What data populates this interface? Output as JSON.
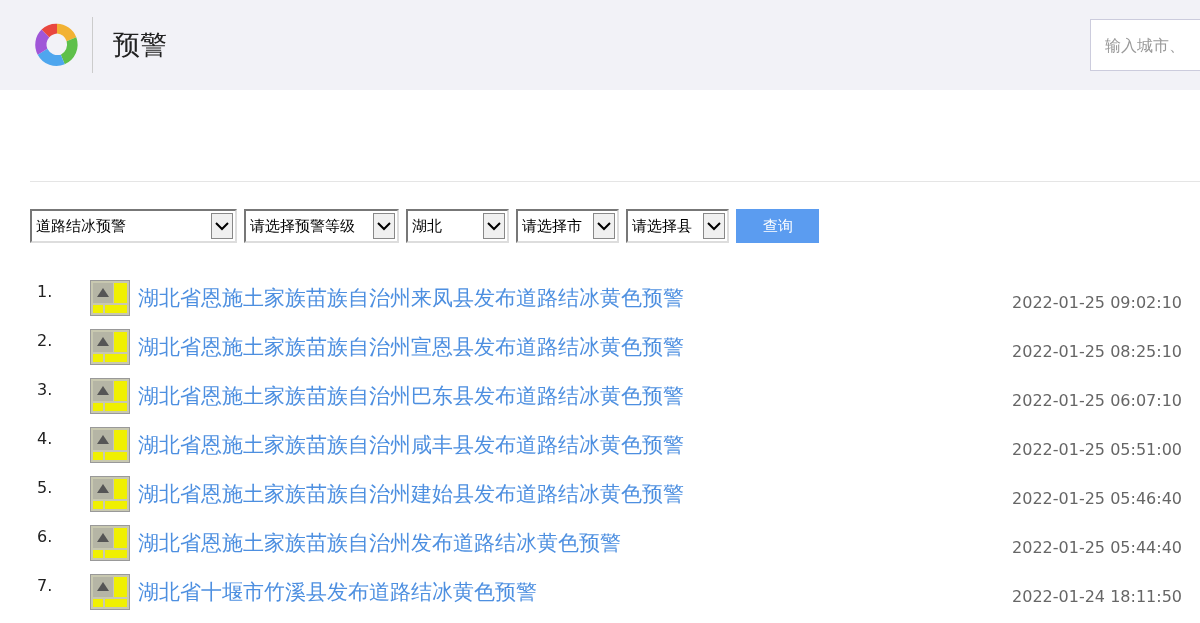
{
  "header": {
    "title": "预警",
    "search": {
      "placeholder": "输入城市、"
    }
  },
  "filters": [
    {
      "value": "道路结冰预警",
      "kind": "wide"
    },
    {
      "value": "请选择预警等级",
      "kind": "mid"
    },
    {
      "value": "湖北",
      "kind": "narrow"
    },
    {
      "value": "请选择市",
      "kind": "narrow"
    },
    {
      "value": "请选择县",
      "kind": "narrow"
    }
  ],
  "query_button": "查询",
  "alerts": [
    {
      "index": "1.",
      "title": "湖北省恩施土家族苗族自治州来凤县发布道路结冰黄色预警",
      "time": "2022-01-25 09:02:10"
    },
    {
      "index": "2.",
      "title": "湖北省恩施土家族苗族自治州宣恩县发布道路结冰黄色预警",
      "time": "2022-01-25 08:25:10"
    },
    {
      "index": "3.",
      "title": "湖北省恩施土家族苗族自治州巴东县发布道路结冰黄色预警",
      "time": "2022-01-25 06:07:10"
    },
    {
      "index": "4.",
      "title": "湖北省恩施土家族苗族自治州咸丰县发布道路结冰黄色预警",
      "time": "2022-01-25 05:51:00"
    },
    {
      "index": "5.",
      "title": "湖北省恩施土家族苗族自治州建始县发布道路结冰黄色预警",
      "time": "2022-01-25 05:46:40"
    },
    {
      "index": "6.",
      "title": "湖北省恩施土家族苗族自治州发布道路结冰黄色预警",
      "time": "2022-01-25 05:44:40"
    },
    {
      "index": "7.",
      "title": "湖北省十堰市竹溪县发布道路结冰黄色预警",
      "time": "2022-01-24 18:11:50"
    }
  ]
}
